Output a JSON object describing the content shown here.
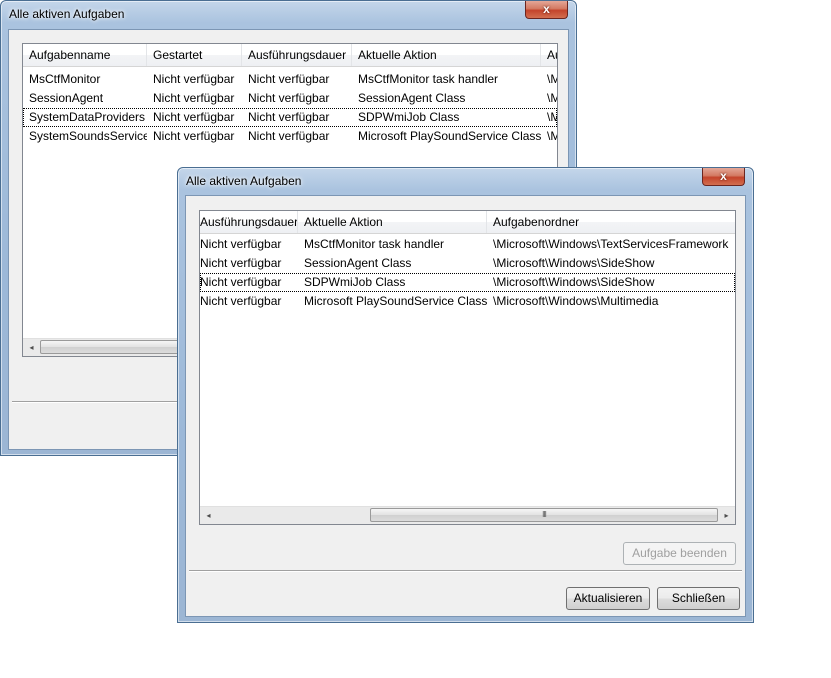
{
  "back_window": {
    "title": "Alle aktiven Aufgaben",
    "close_label": "x",
    "columns": [
      "Aufgabenname",
      "Gestartet",
      "Ausführungsdauer",
      "Aktuelle Aktion",
      "Au"
    ],
    "rows": [
      [
        "MsCtfMonitor",
        "Nicht verfügbar",
        "Nicht verfügbar",
        "MsCtfMonitor task handler",
        "\\M"
      ],
      [
        "SessionAgent",
        "Nicht verfügbar",
        "Nicht verfügbar",
        "SessionAgent Class",
        "\\M"
      ],
      [
        "SystemDataProviders",
        "Nicht verfügbar",
        "Nicht verfügbar",
        "SDPWmiJob Class",
        "\\M"
      ],
      [
        "SystemSoundsService",
        "Nicht verfügbar",
        "Nicht verfügbar",
        "Microsoft PlaySoundService Class",
        "\\M"
      ]
    ],
    "scroll_left": "◂"
  },
  "front_window": {
    "title": "Alle aktiven Aufgaben",
    "close_label": "x",
    "columns": [
      "Ausführungsdauer",
      "Aktuelle Aktion",
      "Aufgabenordner"
    ],
    "rows": [
      [
        "Nicht verfügbar",
        "MsCtfMonitor task handler",
        "\\Microsoft\\Windows\\TextServicesFramework"
      ],
      [
        "Nicht verfügbar",
        "SessionAgent Class",
        "\\Microsoft\\Windows\\SideShow"
      ],
      [
        "Nicht verfügbar",
        "SDPWmiJob Class",
        "\\Microsoft\\Windows\\SideShow"
      ],
      [
        "Nicht verfügbar",
        "Microsoft PlaySoundService Class",
        "\\Microsoft\\Windows\\Multimedia"
      ]
    ],
    "scroll_left": "◂",
    "scroll_right": "▸",
    "thumb_grip": "III",
    "end_task_button": "Aufgabe beenden",
    "refresh_button": "Aktualisieren",
    "close_button": "Schließen"
  }
}
